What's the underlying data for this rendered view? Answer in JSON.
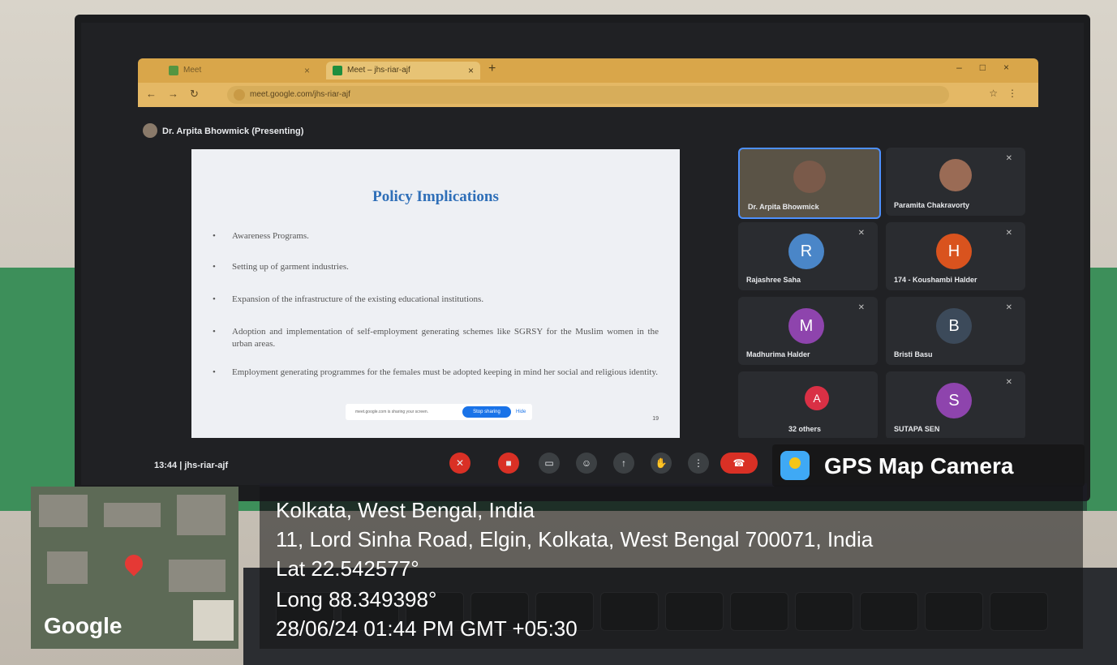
{
  "browser": {
    "tab1_label": "Meet",
    "tab2_label": "Meet – jhs-riar-ajf",
    "url": "meet.google.com/jhs-riar-ajf"
  },
  "meet": {
    "presenter_label": "Dr. Arpita Bhowmick (Presenting)",
    "meeting_time": "13:44",
    "meeting_code": "jhs-riar-ajf"
  },
  "slide": {
    "title": "Policy Implications",
    "bullets": [
      "Awareness Programs.",
      "Setting up of garment industries.",
      "Expansion of the infrastructure of the existing educational institutions.",
      "Adoption and implementation of self-employment generating schemes like SGRSY for the Muslim women in the urban areas.",
      "Employment generating programmes for the females must be adopted keeping in mind her social and religious identity."
    ],
    "page_number": "19",
    "share_text": "meet.google.com is sharing your screen.",
    "stop_sharing_label": "Stop sharing",
    "hide_label": "Hide"
  },
  "participants": [
    {
      "name": "Dr. Arpita Bhowmick",
      "initial": "",
      "color": ""
    },
    {
      "name": "Paramita Chakravorty",
      "initial": "",
      "color": ""
    },
    {
      "name": "Rajashree Saha",
      "initial": "R",
      "color": "#4a86c8"
    },
    {
      "name": "174 - Koushambi Halder",
      "initial": "H",
      "color": "#d9531e"
    },
    {
      "name": "Madhurima Halder",
      "initial": "M",
      "color": "#8e44ad"
    },
    {
      "name": "Bristi Basu",
      "initial": "B",
      "color": "#3c4a5a"
    },
    {
      "name": "32 others",
      "initial": "A",
      "color": "#d93045"
    },
    {
      "name": "SUTAPA SEN",
      "initial": "S",
      "color": "#8e44ad"
    }
  ],
  "gps": {
    "app_label": "GPS Map Camera",
    "place": "Kolkata, West Bengal, India",
    "address": "11, Lord Sinha Road, Elgin, Kolkata, West Bengal 700071, India",
    "lat": "Lat 22.542577°",
    "long": "Long 88.349398°",
    "datetime": "28/06/24 01:44 PM GMT +05:30",
    "map_brand": "Google"
  },
  "icons": {
    "mic": "mic-off-icon",
    "camera": "camera-off-icon",
    "captions": "captions-icon",
    "emoji": "emoji-icon",
    "present": "present-icon",
    "hand": "raise-hand-icon",
    "more": "more-options-icon",
    "end_call": "end-call-icon"
  }
}
